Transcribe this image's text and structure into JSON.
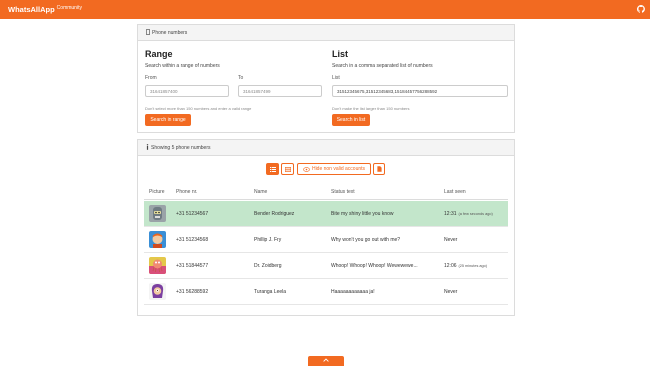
{
  "nav": {
    "brand": "WhatsAllApp",
    "brand_sub": "Community",
    "github_icon": "github-icon"
  },
  "phone_card": {
    "header": "Phone numbers",
    "range": {
      "title": "Range",
      "desc": "Search within a range of numbers",
      "from_label": "From",
      "from_placeholder": "31641857400",
      "to_label": "To",
      "to_placeholder": "31641857499",
      "hint": "Don't select more than 150 numbers and enter a valid range",
      "button": "Search in range"
    },
    "list": {
      "title": "List",
      "desc": "Search in a comma separated list of numbers",
      "label": "List",
      "value": "31512345675,31512345683,15184457756288592",
      "hint": "Don't make the list larger than 150 numbers",
      "button": "Search in list"
    }
  },
  "results_card": {
    "header": "Showing 5 phone numbers",
    "toolbar": {
      "hide_label": "Hide non valid accounts"
    },
    "columns": [
      "Picture",
      "Phone nr.",
      "Name",
      "Status text",
      "Last seen"
    ],
    "rows": [
      {
        "phone": "+31 51234567",
        "name": "Bender Rodriguez",
        "status": "Bite my shiny little you know",
        "last_seen": "12:31",
        "last_seen_note": "(a few seconds ago)",
        "highlight": true
      },
      {
        "phone": "+31 51234568",
        "name": "Phillip J. Fry",
        "status": "Why won't you go out with me?",
        "last_seen": "Never",
        "last_seen_note": ""
      },
      {
        "phone": "+31 51844577",
        "name": "Dr. Zoidberg",
        "status": "Whoop! Whoop! Whoop! Wewewewe...",
        "last_seen": "12:06",
        "last_seen_note": "(25 minutes ago)"
      },
      {
        "phone": "+31 56288592",
        "name": "Turanga Leela",
        "status": "Haaaaaaaaaaaa ja!",
        "last_seen": "Never",
        "last_seen_note": ""
      }
    ]
  },
  "colors": {
    "accent": "#f26a21",
    "highlight_row": "#c3e6cb"
  }
}
